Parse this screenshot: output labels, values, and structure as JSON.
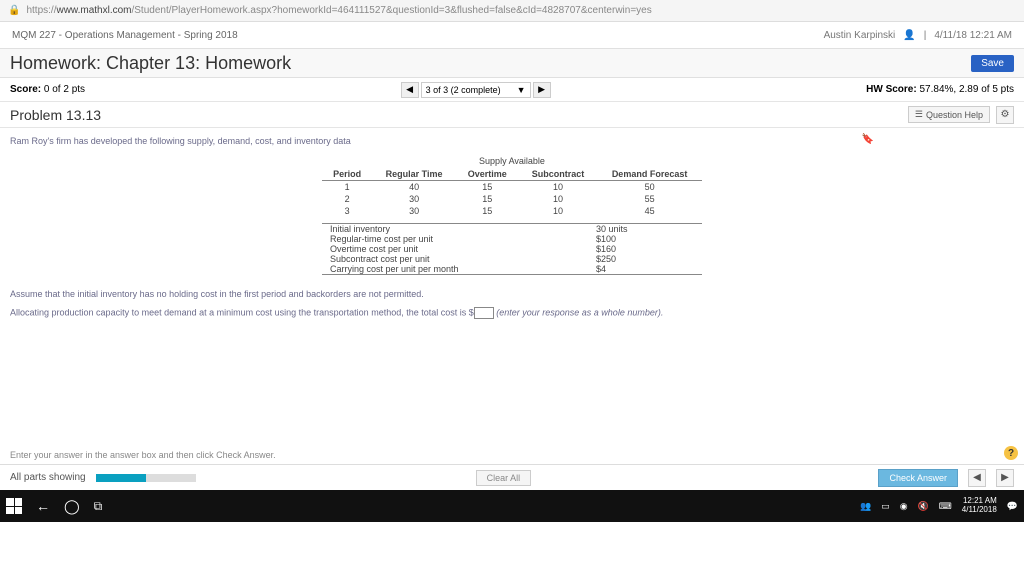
{
  "url": {
    "prefix": "https://",
    "domain": "www.mathxl.com",
    "path": "/Student/PlayerHomework.aspx?homeworkId=464111527&questionId=3&flushed=false&cId=4828707&centerwin=yes"
  },
  "course": {
    "name": "MQM 227 - Operations Management - Spring 2018",
    "user": "Austin Karpinski",
    "timestamp": "4/11/18 12:21 AM"
  },
  "hw": {
    "title": "Homework: Chapter 13: Homework",
    "save": "Save"
  },
  "score": {
    "label": "Score:",
    "value": "0 of 2 pts",
    "nav": "3 of 3 (2 complete)",
    "hw_label": "HW Score:",
    "hw_value": "57.84%, 2.89 of 5 pts"
  },
  "problem": {
    "id": "Problem 13.13",
    "qhelp": "Question Help"
  },
  "intro": "Ram Roy's firm has developed the following supply, demand, cost, and inventory data",
  "table": {
    "caption": "Supply Available",
    "headers": [
      "Period",
      "Regular Time",
      "Overtime",
      "Subcontract",
      "Demand Forecast"
    ],
    "rows": [
      [
        "1",
        "40",
        "15",
        "10",
        "50"
      ],
      [
        "2",
        "30",
        "15",
        "10",
        "55"
      ],
      [
        "3",
        "30",
        "15",
        "10",
        "45"
      ]
    ]
  },
  "costs": [
    [
      "Initial inventory",
      "30 units"
    ],
    [
      "Regular-time cost per unit",
      "$100"
    ],
    [
      "Overtime cost per unit",
      "$160"
    ],
    [
      "Subcontract cost per unit",
      "$250"
    ],
    [
      "Carrying cost per unit per month",
      "$4"
    ]
  ],
  "assume": "Assume that the initial inventory has no holding cost in the first period and backorders are not permitted.",
  "question_pre": "Allocating production capacity to meet demand at a minimum cost using the transportation method, the total cost is $",
  "question_post": " (enter your response as a whole number).",
  "footer_note": "Enter your answer in the answer box and then click Check Answer.",
  "bottom": {
    "parts": "All parts showing",
    "clear": "Clear All",
    "check": "Check Answer"
  },
  "taskbar": {
    "time": "12:21 AM",
    "date": "4/11/2018"
  }
}
